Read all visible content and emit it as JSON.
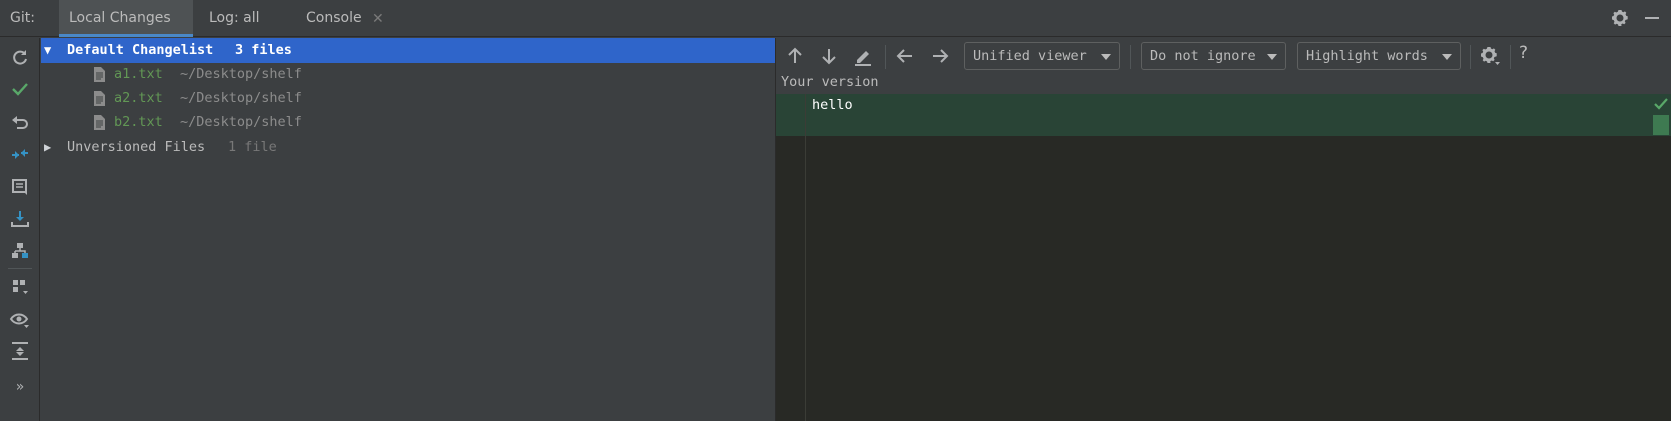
{
  "tabbar": {
    "git_label": "Git:",
    "tabs": [
      {
        "label": "Local Changes",
        "active": true
      },
      {
        "label": "Log: all",
        "active": false
      },
      {
        "label": "Console",
        "active": false,
        "closable": true
      }
    ],
    "close_glyph": "✕"
  },
  "left_toolbar": {
    "icons": [
      "refresh-icon",
      "commit-check-icon",
      "rollback-icon",
      "diff-icon",
      "changelist-icon",
      "shelve-icon",
      "merge-icon",
      "group-by-icon",
      "view-options-icon",
      "expand-collapse-icon",
      "more-icon"
    ]
  },
  "tree": {
    "changelist": {
      "name": "Default Changelist",
      "count": "3 files",
      "expanded": true
    },
    "files": [
      {
        "name": "a1.txt",
        "path": "~/Desktop/shelf"
      },
      {
        "name": "a2.txt",
        "path": "~/Desktop/shelf"
      },
      {
        "name": "b2.txt",
        "path": "~/Desktop/shelf"
      }
    ],
    "unversioned": {
      "name": "Unversioned Files",
      "count": "1 file",
      "expanded": false
    }
  },
  "diff_toolbar": {
    "viewer": "Unified viewer",
    "ignore": "Do not ignore",
    "highlight": "Highlight words",
    "help": "?"
  },
  "editor": {
    "version_label": "Your version",
    "lines": [
      "hello"
    ]
  },
  "colors": {
    "selection": "#2f65ca",
    "added_background": "#294436",
    "file_added": "#629755",
    "accent": "#4a88c7"
  },
  "more_glyph": "»"
}
